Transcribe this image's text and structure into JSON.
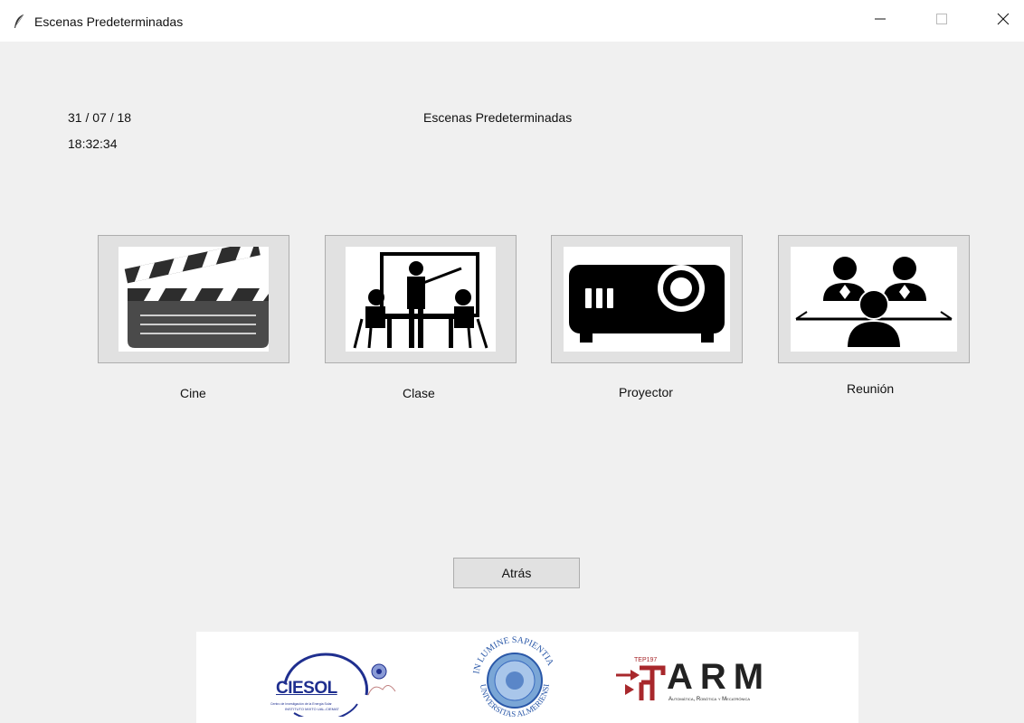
{
  "window": {
    "title": "Escenas Predeterminadas",
    "icon": "feather-icon",
    "controls": [
      "minimize-icon",
      "maximize-icon",
      "close-icon"
    ]
  },
  "header": {
    "date": "31 / 07 / 18",
    "time": "18:32:34",
    "heading": "Escenas Predeterminadas"
  },
  "scenes": [
    {
      "label": "Cine",
      "icon": "clapperboard-icon"
    },
    {
      "label": "Clase",
      "icon": "classroom-icon"
    },
    {
      "label": "Proyector",
      "icon": "projector-icon"
    },
    {
      "label": "Reunión",
      "icon": "meeting-icon"
    }
  ],
  "back_button": {
    "label": "Atrás"
  },
  "logos": {
    "ciesol": {
      "name": "CIESOL",
      "caption_line1": "Centro de Investigación de la Energía Solar",
      "caption_line2": "INSTITUTO MIXTO UAL-CIEMAT"
    },
    "university": {
      "motto_top": "IN LUMINE SAPIENTIA",
      "motto_bottom": "UNIVERSITAS ALMERIENSIS"
    },
    "arm": {
      "tag": "TEP197",
      "name": "ARM",
      "subtitle": "Automática, Robótica y Mecatrónica"
    }
  },
  "colors": {
    "window_bg": "#f0f0f0",
    "button_face": "#e1e1e1",
    "button_border": "#adadad",
    "ciesol_blue": "#1f2f8f",
    "arm_red": "#a8282c"
  }
}
